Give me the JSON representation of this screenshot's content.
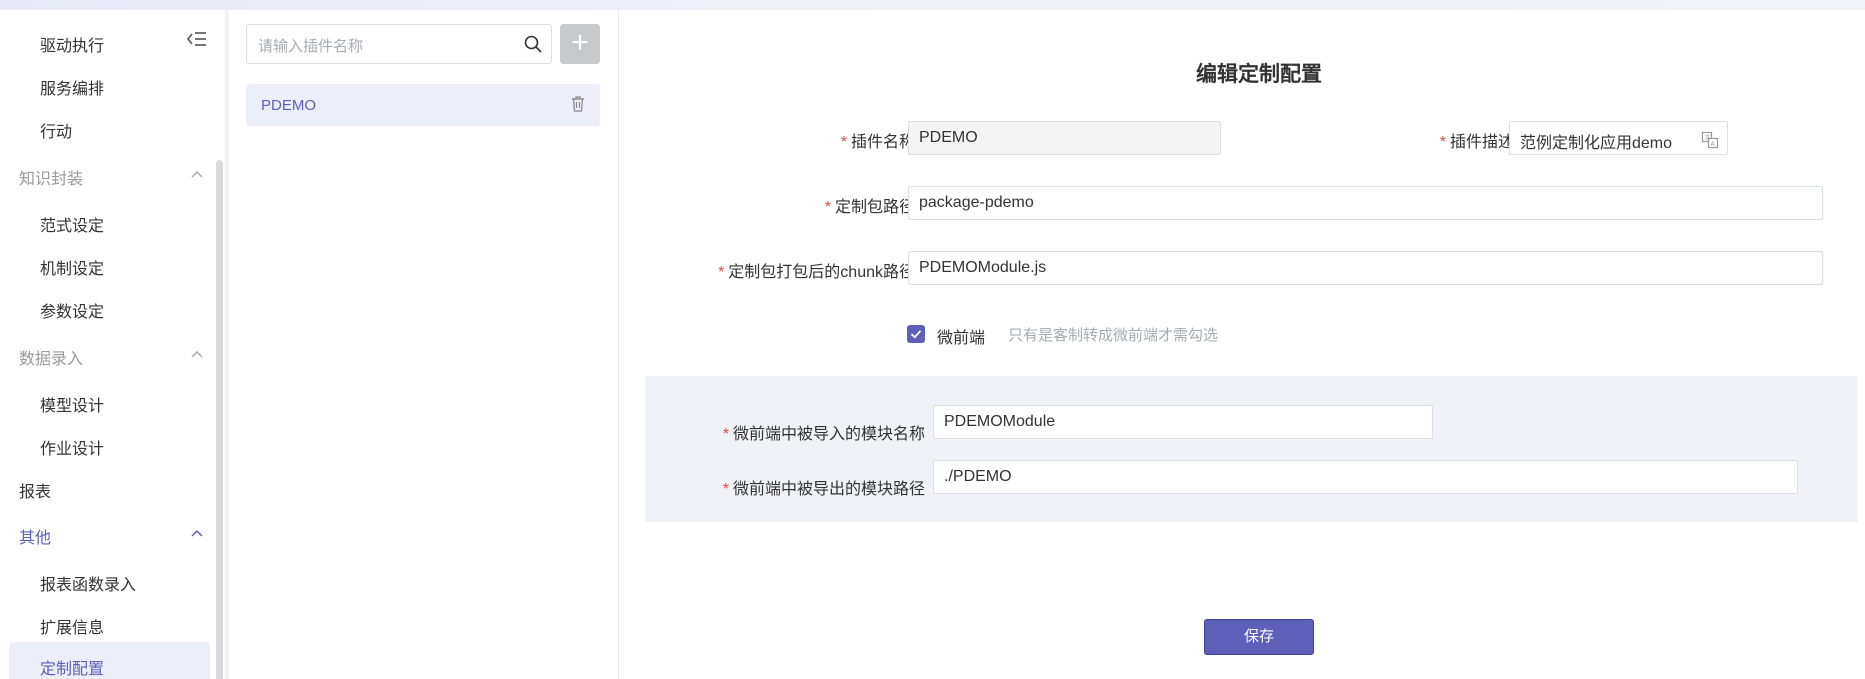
{
  "sidebar": {
    "items": {
      "drive_exec": "驱动执行",
      "service_orchestration": "服务编排",
      "action": "行动",
      "group_knowledge": "知识封装",
      "paradigm_setting": "范式设定",
      "mechanism_setting": "机制设定",
      "param_setting": "参数设定",
      "group_data_entry": "数据录入",
      "model_design": "模型设计",
      "job_design": "作业设计",
      "report": "报表",
      "group_other": "其他",
      "report_func_entry": "报表函数录入",
      "extension_info": "扩展信息",
      "custom_config": "定制配置"
    }
  },
  "plugin_panel": {
    "search_placeholder": "请输入插件名称",
    "add_label": "+",
    "plugins": [
      {
        "name": "PDEMO"
      }
    ]
  },
  "form": {
    "title": "编辑定制配置",
    "required_mark": "*",
    "plugin_name_label": "插件名称",
    "plugin_name_value": "PDEMO",
    "plugin_desc_label": "插件描述",
    "plugin_desc_value": "范例定制化应用demo",
    "package_path_label": "定制包路径",
    "package_path_value": "package-pdemo",
    "chunk_path_label": "定制包打包后的chunk路径",
    "chunk_path_value": "PDEMOModule.js",
    "micro_frontend_label": "微前端",
    "micro_frontend_checked": true,
    "micro_frontend_hint": "只有是客制转成微前端才需勾选",
    "import_module_label": "微前端中被导入的模块名称",
    "import_module_value": "PDEMOModule",
    "export_path_label": "微前端中被导出的模块路径",
    "export_path_value": "./PDEMO",
    "save_label": "保存"
  },
  "colors": {
    "accent": "#5d5fb8",
    "required": "#e34d4d",
    "selected_bg": "#eceffa",
    "subsection_bg": "#f0f2f7"
  }
}
